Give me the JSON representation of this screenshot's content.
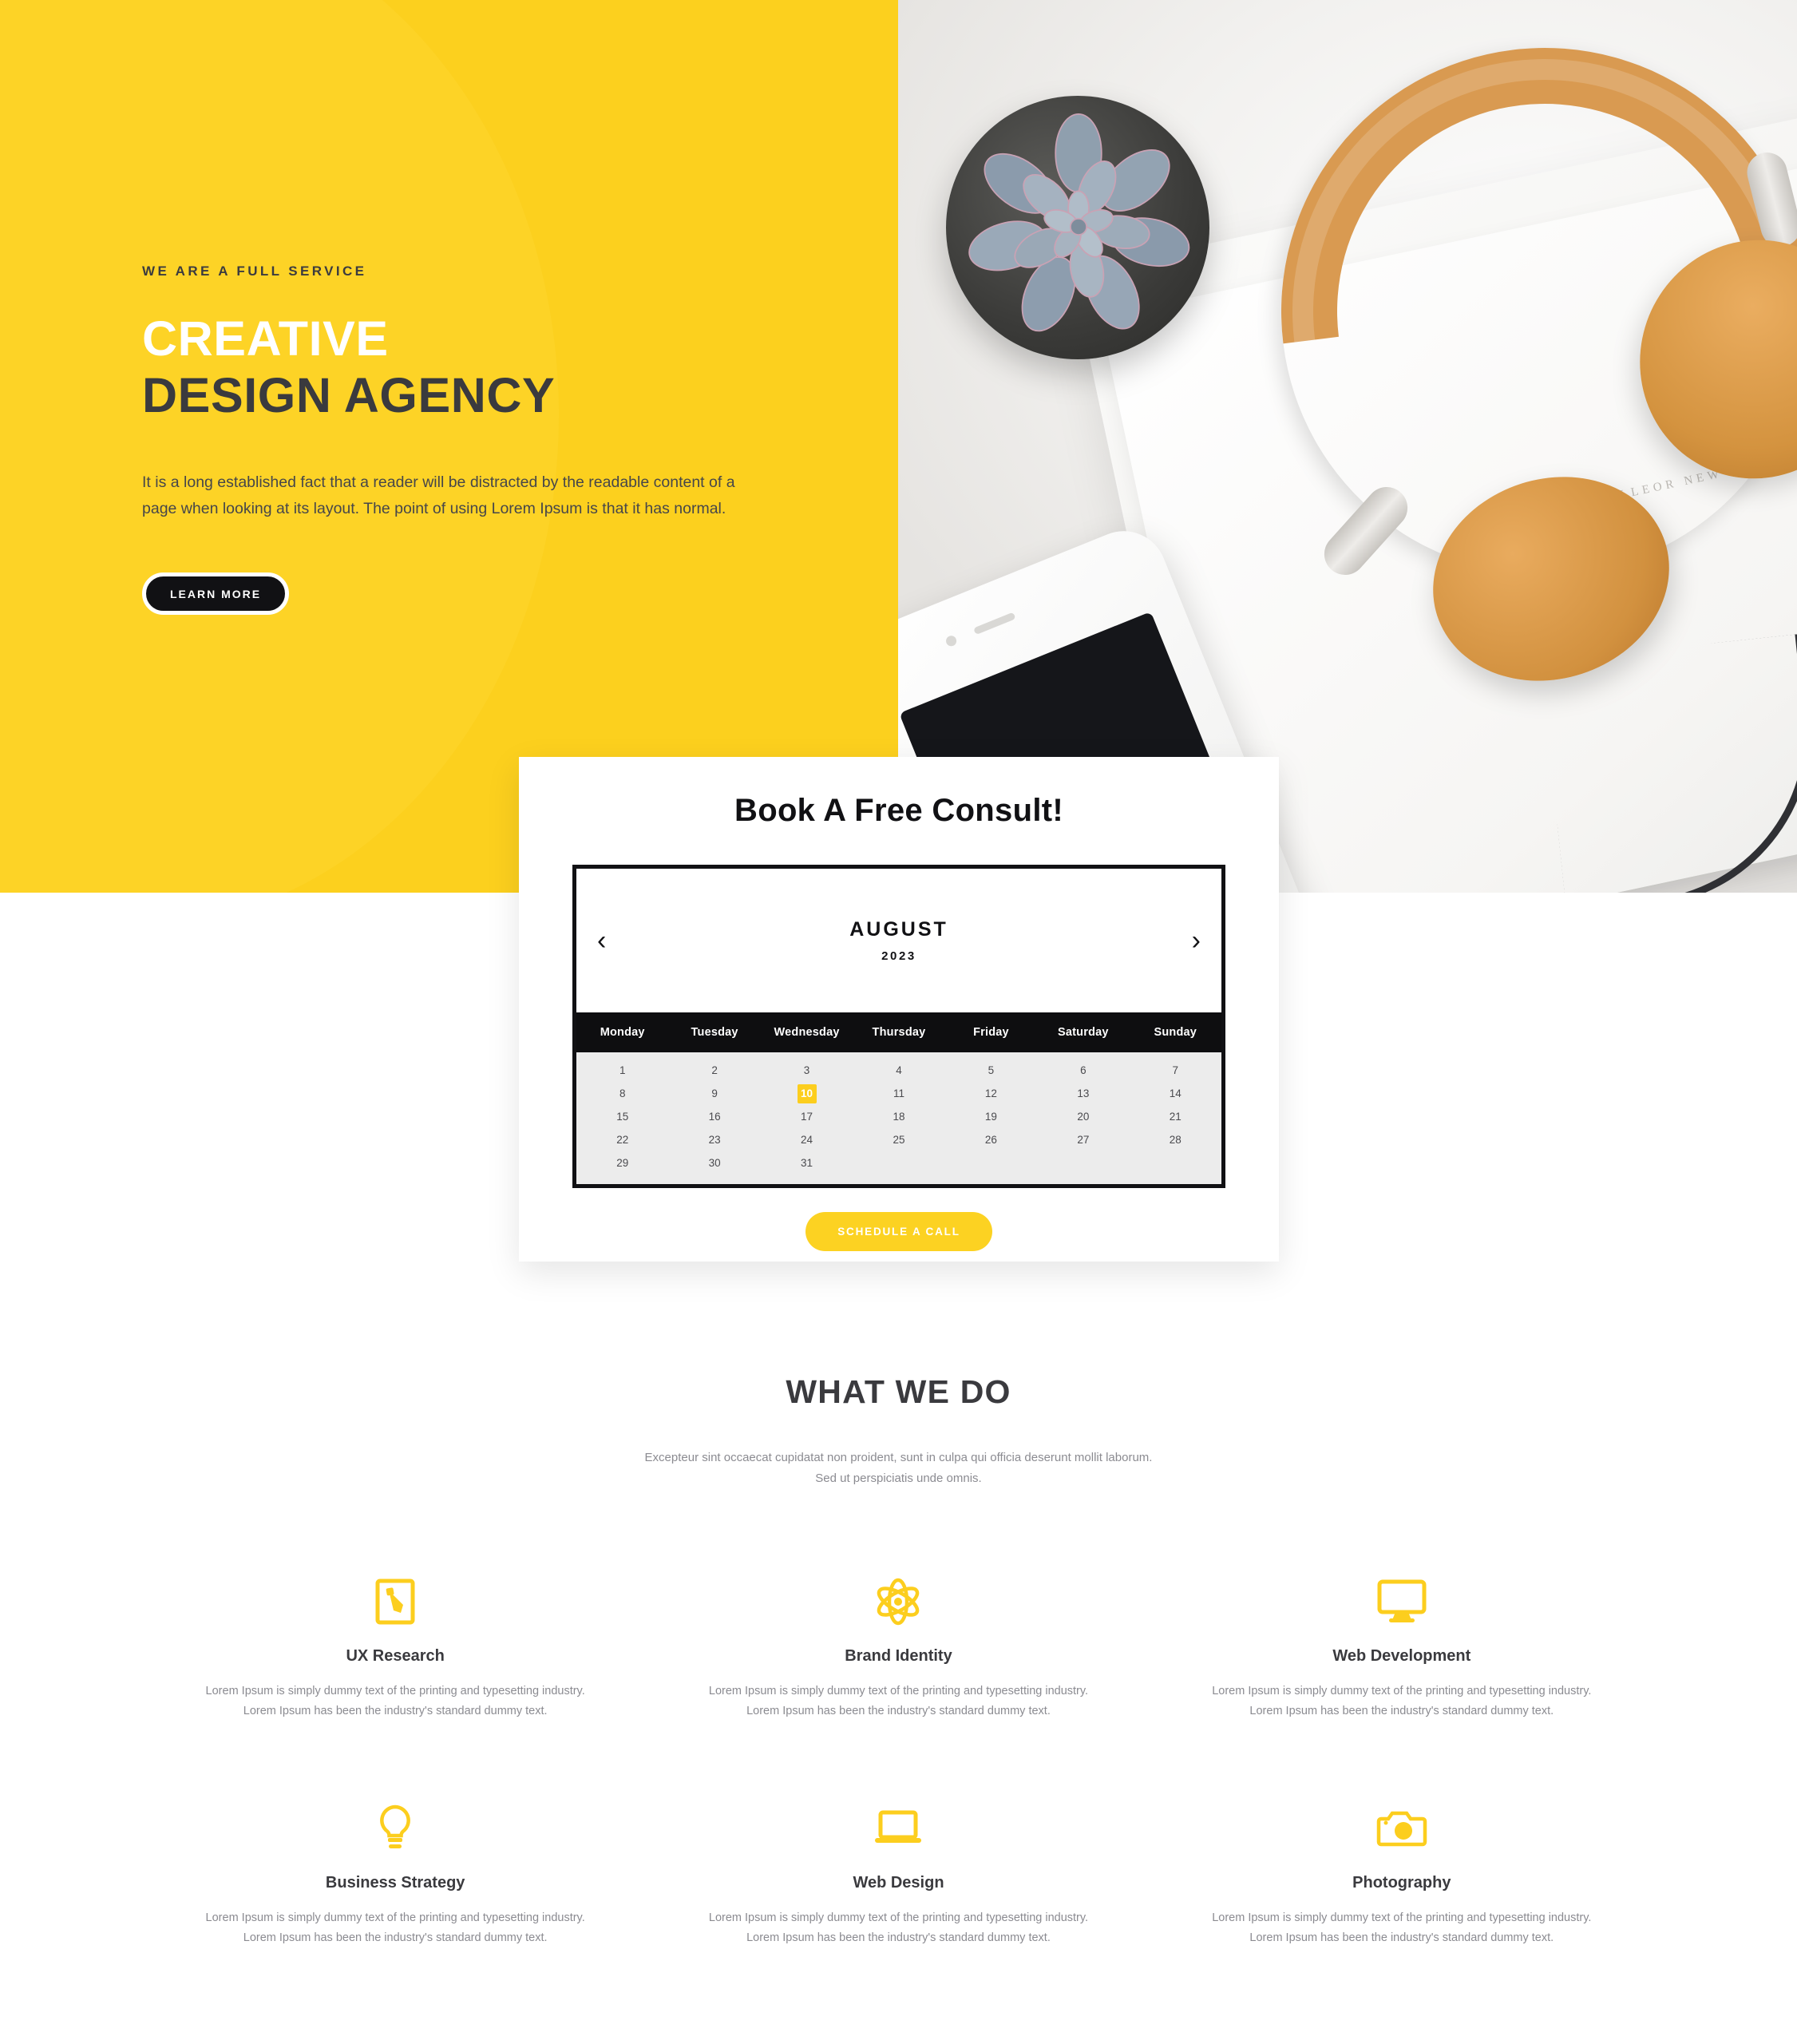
{
  "colors": {
    "brand_yellow": "#FCD01E",
    "accent_yellow": "#FCCE1E",
    "dark": "#3A3A3E",
    "black": "#111114",
    "muted": "#8B8B91"
  },
  "hero": {
    "eyebrow": "WE ARE A FULL SERVICE",
    "title_line1": "CREATIVE",
    "title_line2": "DESIGN AGENCY",
    "paragraph": "It is a long established fact that a reader will be distracted by the readable content of a page when looking at its layout. The point of using Lorem Ipsum is that it has normal.",
    "cta_label": "LEARN MORE",
    "photo_caption": "CALLEOR NEW MAR"
  },
  "consult": {
    "title": "Book A Free Consult!",
    "prev_label": "‹",
    "next_label": "›",
    "month": "AUGUST",
    "year": "2023",
    "weekdays": [
      "Monday",
      "Tuesday",
      "Wednesday",
      "Thursday",
      "Friday",
      "Saturday",
      "Sunday"
    ],
    "leading_blanks": 0,
    "days": [
      1,
      2,
      3,
      4,
      5,
      6,
      7,
      8,
      9,
      10,
      11,
      12,
      13,
      14,
      15,
      16,
      17,
      18,
      19,
      20,
      21,
      22,
      23,
      24,
      25,
      26,
      27,
      28,
      29,
      30,
      31
    ],
    "selected_day": 10,
    "schedule_label": "SCHEDULE A CALL"
  },
  "what_we_do": {
    "title": "WHAT WE DO",
    "subtitle": "Excepteur sint occaecat cupidatat non proident, sunt in culpa qui officia deserunt mollit laborum. Sed ut perspiciatis unde omnis.",
    "body_text": "Lorem Ipsum is simply dummy text of the printing and typesetting industry. Lorem Ipsum has been the industry's standard dummy text.",
    "services": [
      {
        "icon": "pencil-square-icon",
        "title": "UX Research",
        "text": "Lorem Ipsum is simply dummy text of the printing and typesetting industry. Lorem Ipsum has been the industry's standard dummy text."
      },
      {
        "icon": "atom-icon",
        "title": "Brand Identity",
        "text": "Lorem Ipsum is simply dummy text of the printing and typesetting industry. Lorem Ipsum has been the industry's standard dummy text."
      },
      {
        "icon": "monitor-icon",
        "title": "Web Development",
        "text": "Lorem Ipsum is simply dummy text of the printing and typesetting industry. Lorem Ipsum has been the industry's standard dummy text."
      },
      {
        "icon": "lightbulb-icon",
        "title": "Business Strategy",
        "text": "Lorem Ipsum is simply dummy text of the printing and typesetting industry. Lorem Ipsum has been the industry's standard dummy text."
      },
      {
        "icon": "laptop-icon",
        "title": "Web Design",
        "text": "Lorem Ipsum is simply dummy text of the printing and typesetting industry. Lorem Ipsum has been the industry's standard dummy text."
      },
      {
        "icon": "camera-icon",
        "title": "Photography",
        "text": "Lorem Ipsum is simply dummy text of the printing and typesetting industry. Lorem Ipsum has been the industry's standard dummy text."
      }
    ]
  }
}
